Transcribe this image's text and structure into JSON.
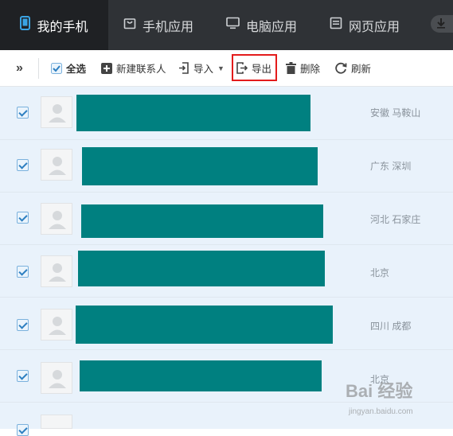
{
  "nav": {
    "tabs": [
      {
        "label": "我的手机",
        "icon": "phone-icon",
        "active": true
      },
      {
        "label": "手机应用",
        "icon": "bag-icon",
        "active": false
      },
      {
        "label": "电脑应用",
        "icon": "monitor-icon",
        "active": false
      },
      {
        "label": "网页应用",
        "icon": "webpage-icon",
        "active": false
      }
    ],
    "download_icon": "download-icon"
  },
  "toolbar": {
    "expand_label": "»",
    "select_all_label": "全选",
    "new_contact_label": "新建联系人",
    "import_label": "导入",
    "export_label": "导出",
    "delete_label": "删除",
    "refresh_label": "刷新",
    "highlight_color": "#e31b1b"
  },
  "contacts": [
    {
      "location": "安徽 马鞍山",
      "checked": true
    },
    {
      "location": "广东 深圳",
      "checked": true
    },
    {
      "location": "河北 石家庄",
      "checked": true
    },
    {
      "location": "北京",
      "checked": true
    },
    {
      "location": "四川 成都",
      "checked": true
    },
    {
      "location": "北京",
      "checked": true
    }
  ],
  "redaction_color": "#008080",
  "watermark": {
    "text": "Bai 经验",
    "sub": "jingyan.baidu.com"
  }
}
